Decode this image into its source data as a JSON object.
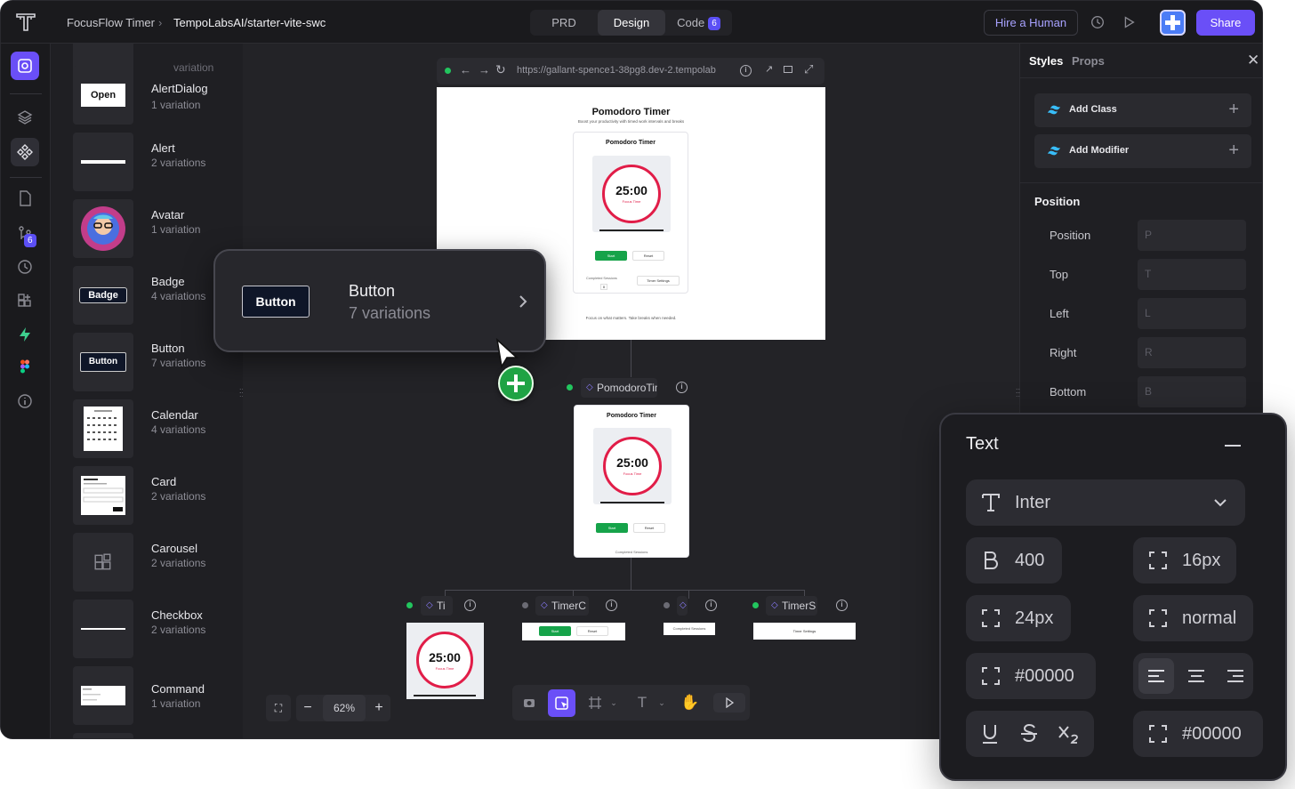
{
  "header": {
    "project": "FocusFlow Timer",
    "repo": "TempoLabsAI/starter-vite-swc",
    "tabs": [
      {
        "label": "PRD"
      },
      {
        "label": "Design"
      },
      {
        "label": "Code",
        "count": "6"
      }
    ],
    "hire_label": "Hire a Human",
    "share_label": "Share"
  },
  "rail": {
    "notification_count": "6"
  },
  "components": [
    {
      "name": "",
      "variations": "variation",
      "thumb": ""
    },
    {
      "name": "AlertDialog",
      "variations": "1 variation",
      "thumb": "Open"
    },
    {
      "name": "Alert",
      "variations": "2 variations",
      "thumb": ""
    },
    {
      "name": "Avatar",
      "variations": "1 variation",
      "thumb": ""
    },
    {
      "name": "Badge",
      "variations": "4 variations",
      "thumb": "Badge"
    },
    {
      "name": "Button",
      "variations": "7 variations",
      "thumb": "Button"
    },
    {
      "name": "Calendar",
      "variations": "4 variations",
      "thumb": ""
    },
    {
      "name": "Card",
      "variations": "2 variations",
      "thumb": ""
    },
    {
      "name": "Carousel",
      "variations": "2 variations",
      "thumb": ""
    },
    {
      "name": "Checkbox",
      "variations": "2 variations",
      "thumb": ""
    },
    {
      "name": "Command",
      "variations": "1 variation",
      "thumb": ""
    }
  ],
  "canvas": {
    "url": "https://gallant-spence1-38pg8.dev-2.tempolab",
    "page_title": "Pomodoro Timer",
    "page_subtitle": "Boost your productivity with timed work intervals and breaks",
    "card_title": "Pomodoro Timer",
    "time": "25:00",
    "focus_label": "Focus Time",
    "start_label": "Start",
    "reset_label": "Reset",
    "sessions_label": "Completed Sessions",
    "sessions_count": "0",
    "settings_label": "Timer Settings",
    "footer_text": "Focus on what matters. Take breaks when needed.",
    "node_main": "PomodoroTim",
    "node_a": "Ti",
    "node_b": "TimerC",
    "node_c": "",
    "node_d": "TimerS",
    "zoom": "62%"
  },
  "popup": {
    "thumb_label": "Button",
    "title": "Button",
    "subtitle": "7 variations"
  },
  "panel": {
    "tabs": [
      "Styles",
      "Props"
    ],
    "add_class": "Add Class",
    "add_modifier": "Add Modifier",
    "section": "Position",
    "rows": [
      {
        "label": "Position",
        "placeholder": "P"
      },
      {
        "label": "Top",
        "placeholder": "T"
      },
      {
        "label": "Left",
        "placeholder": "L"
      },
      {
        "label": "Right",
        "placeholder": "R"
      },
      {
        "label": "Bottom",
        "placeholder": "B"
      }
    ]
  },
  "text_panel": {
    "title": "Text",
    "font": "Inter",
    "weight": "400",
    "size": "16px",
    "line_height": "24px",
    "letter_spacing": "normal",
    "color": "#00000",
    "decoration_color": "#00000"
  },
  "colors": {
    "accent": "#6a4ff7",
    "green": "#16a34a",
    "ring": "#e11d48"
  }
}
